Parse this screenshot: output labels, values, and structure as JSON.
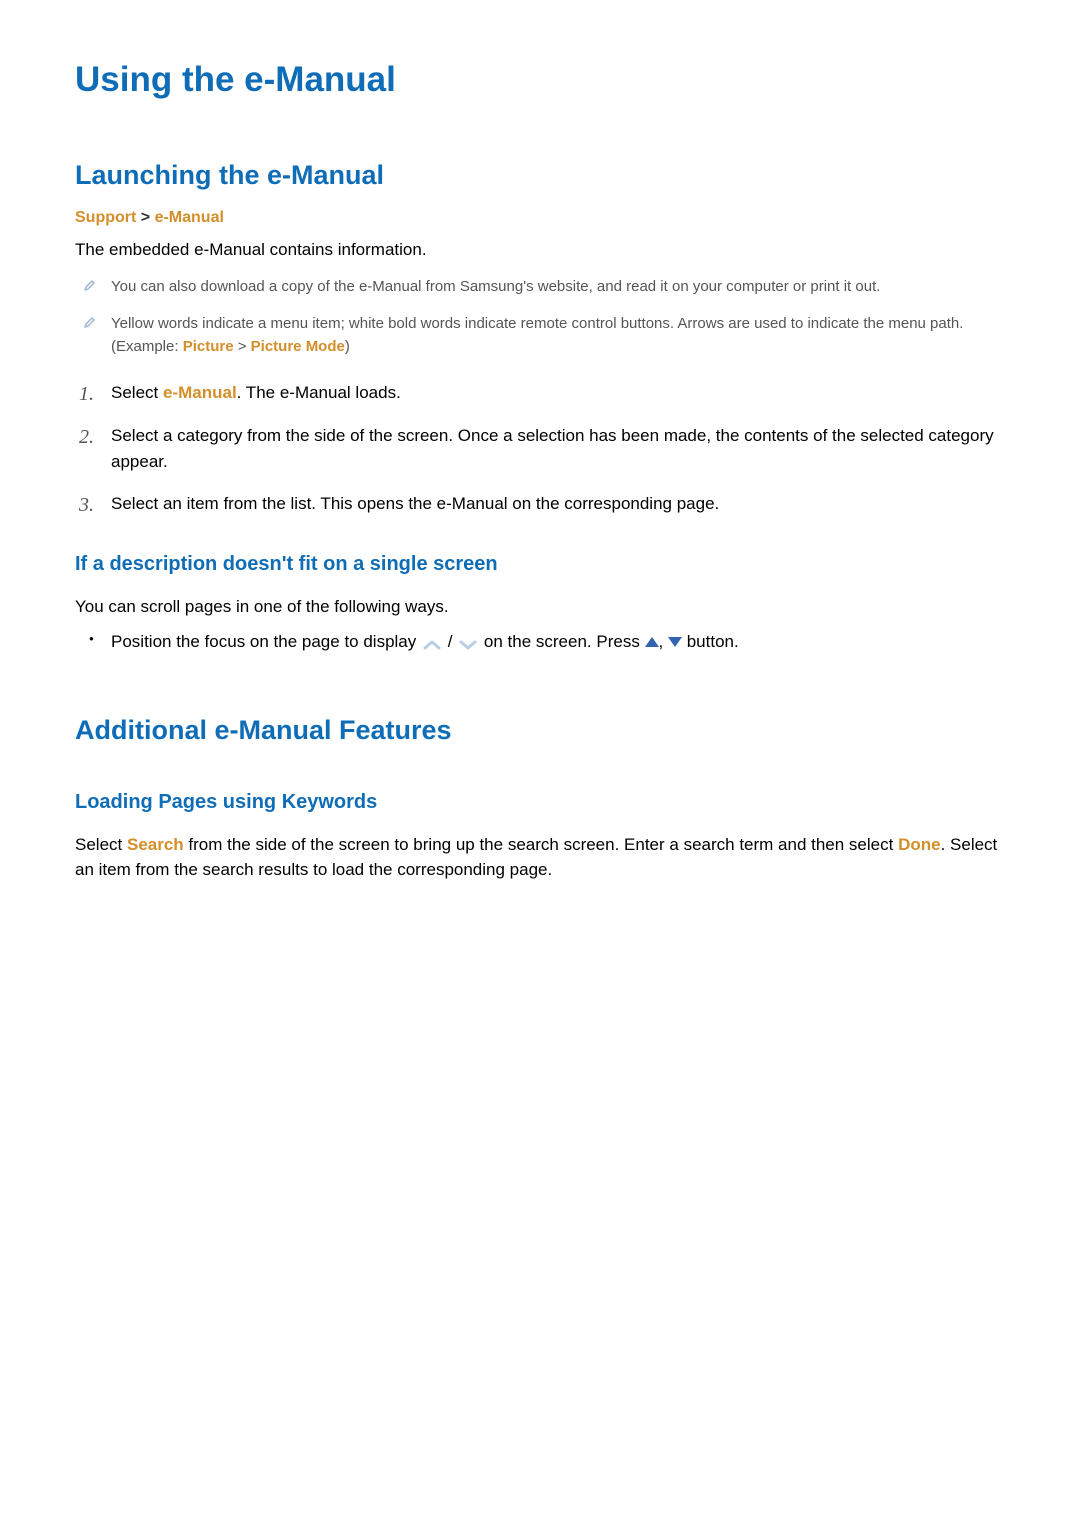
{
  "title": "Using the e-Manual",
  "section1": {
    "heading": "Launching the e-Manual",
    "breadcrumb": {
      "part1": "Support",
      "sep": ">",
      "part2": "e-Manual"
    },
    "intro": "The embedded e-Manual contains information.",
    "notes": [
      {
        "text": "You can also download a copy of the e-Manual from Samsung's website, and read it on your computer or print it out."
      },
      {
        "text_before": "Yellow words indicate a menu item; white bold words indicate remote control buttons. Arrows are used to indicate the menu path. (Example: ",
        "menu1": "Picture",
        "sep": " > ",
        "menu2": "Picture Mode",
        "text_after": ")"
      }
    ],
    "steps": [
      {
        "pre": "Select ",
        "yellow": "e-Manual",
        "post": ". The e-Manual loads."
      },
      {
        "full": "Select a category from the side of the screen. Once a selection has been made, the contents of the selected category appear."
      },
      {
        "full": "Select an item from the list. This opens the e-Manual on the corresponding page."
      }
    ],
    "sub1": {
      "heading": "If a description doesn't fit on a single screen",
      "intro": "You can scroll pages in one of the following ways.",
      "bullet_pre": "Position the focus on the page to display ",
      "bullet_slash": " / ",
      "bullet_mid": " on the screen. Press ",
      "bullet_comma": ", ",
      "bullet_post": " button."
    }
  },
  "section2": {
    "heading": "Additional e-Manual Features",
    "sub1": {
      "heading": "Loading Pages using Keywords",
      "text_pre": "Select ",
      "yellow1": "Search",
      "text_mid": " from the side of the screen to bring up the search screen. Enter a search term and then select ",
      "yellow2": "Done",
      "text_post": ". Select an item from the search results to load the corresponding page."
    }
  }
}
